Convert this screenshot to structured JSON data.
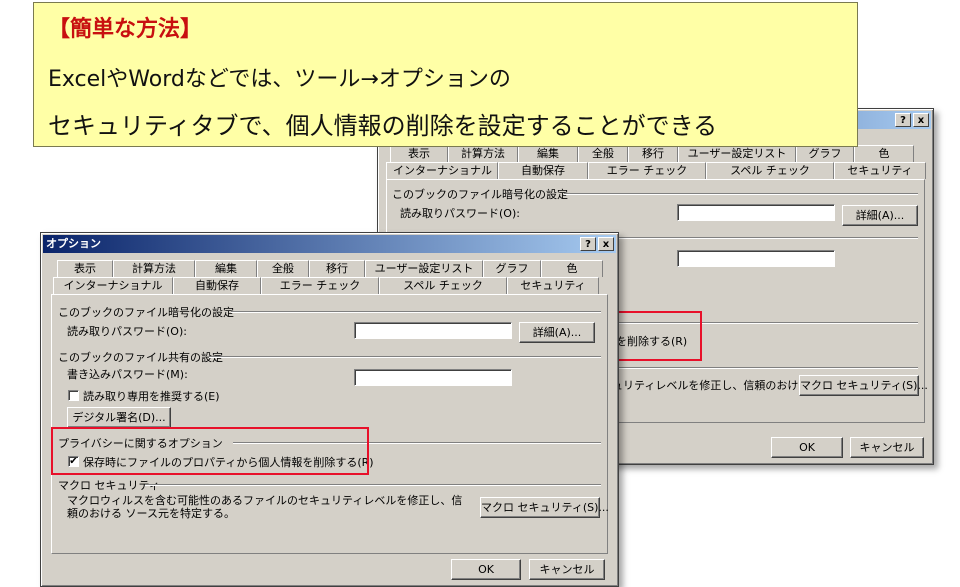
{
  "callout": {
    "heading": "【簡単な方法】",
    "line1": "ExcelやWordなどでは、ツール→オプションの",
    "line2": "セキュリティタブで、個人情報の削除を設定することができる"
  },
  "title_buttons": {
    "help": "?",
    "close": "x"
  },
  "tabs_row1": [
    "表示",
    "計算方法",
    "編集",
    "全般",
    "移行",
    "ユーザー設定リスト",
    "グラフ",
    "色"
  ],
  "tabs_row2": [
    "インターナショナル",
    "自動保存",
    "エラー チェック",
    "スペル チェック",
    "セキュリティ"
  ],
  "dialog": {
    "title": "オプション",
    "encrypt_group": "このブックのファイル暗号化の設定",
    "read_password_label": "読み取りパスワード(O):",
    "read_password_value": "",
    "advanced_button": "詳細(A)...",
    "share_group": "このブックのファイル共有の設定",
    "write_password_label": "書き込みパスワード(M):",
    "write_password_value": "",
    "readonly_recommend_label": "読み取り専用を推奨する(E)",
    "readonly_recommend_checked": false,
    "digital_signature_button": "デジタル署名(D)...",
    "privacy_group": "プライバシーに関するオプション",
    "remove_personal_info_label": "保存時にファイルのプロパティから個人情報を削除する(R)",
    "remove_personal_info_checked": true,
    "check_mark": "✔",
    "macro_group": "マクロ セキュリティ",
    "macro_description": "マクロウィルスを含む可能性のあるファイルのセキュリティレベルを修正し、信頼のおける ソース元を特定する。",
    "macro_button": "マクロ セキュリティ(S)...",
    "ok_button": "OK",
    "cancel_button": "キャンセル"
  },
  "back_dialog": {
    "encrypt_group": "このブックのファイル暗号化の設定",
    "read_password_label": "読み取りパスワード(O):",
    "advanced_button": "詳細(A)...",
    "remove_personal_info_fragment": "を削除する(R)",
    "macro_fragment": "ュリティレベルを修正し、信頼のおける",
    "macro_button": "マクロ セキュリティ(S)...",
    "ok_button": "OK",
    "cancel_button": "キャンセル"
  },
  "colors": {
    "highlight": "#e8102a",
    "callout_bg": "#ffffa6",
    "title_bar": "#0a246a"
  }
}
